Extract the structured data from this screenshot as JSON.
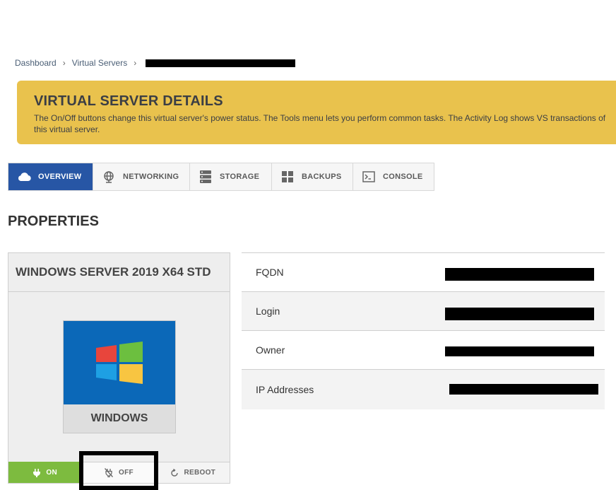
{
  "breadcrumb": {
    "items": [
      "Dashboard",
      "Virtual Servers"
    ],
    "separator": "›"
  },
  "banner": {
    "title": "VIRTUAL SERVER DETAILS",
    "description": "The On/Off buttons change this virtual server's power status. The Tools menu lets you perform common tasks. The Activity Log shows VS transactions of this virtual server."
  },
  "tabs": [
    {
      "label": "OVERVIEW",
      "icon": "cloud-icon",
      "active": true
    },
    {
      "label": "NETWORKING",
      "icon": "globe-icon",
      "active": false
    },
    {
      "label": "STORAGE",
      "icon": "storage-icon",
      "active": false
    },
    {
      "label": "BACKUPS",
      "icon": "grid-icon",
      "active": false
    },
    {
      "label": "CONSOLE",
      "icon": "terminal-icon",
      "active": false
    }
  ],
  "properties": {
    "heading": "PROPERTIES",
    "card_title": "WINDOWS SERVER 2019 X64 STD",
    "os_name": "WINDOWS",
    "power": {
      "on": "ON",
      "off": "OFF",
      "reboot": "REBOOT"
    },
    "fields": [
      {
        "label": "FQDN"
      },
      {
        "label": "Login"
      },
      {
        "label": "Owner"
      },
      {
        "label": "IP Addresses"
      }
    ]
  },
  "colors": {
    "banner": "#e9c24d",
    "active_tab": "#2756a5",
    "power_on": "#7dbb3f",
    "windows_blue": "#0b68b8"
  }
}
